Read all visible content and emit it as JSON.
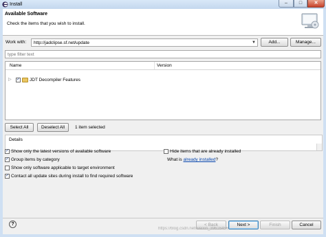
{
  "window": {
    "title": "Install"
  },
  "header": {
    "title": "Available Software",
    "description": "Check the items that you wish to install."
  },
  "work_with": {
    "label": "Work with:",
    "value": "http://jadclipse.sf.net/update",
    "add_label": "Add...",
    "manage_label": "Manage..."
  },
  "filter": {
    "placeholder": "type filter text"
  },
  "tree": {
    "columns": [
      "Name",
      "Version"
    ],
    "items": [
      {
        "label": "JDT Decompiler Features",
        "version": "",
        "checked": true
      }
    ]
  },
  "selection": {
    "select_all": "Select All",
    "deselect_all": "Deselect All",
    "status": "1 item selected"
  },
  "details": {
    "title": "Details"
  },
  "options": {
    "latest_versions": "Show only the latest versions of available software",
    "group_by_category": "Group items by category",
    "applicable_only": "Show only software applicable to target environment",
    "contact_sites": "Contact all update sites during install to find required software",
    "hide_installed": "Hide items that are already installed",
    "what_is_prefix": "What is ",
    "what_is_link": "already installed",
    "what_is_suffix": "?"
  },
  "buttons": {
    "back": "< Back",
    "next": "Next >",
    "finish": "Finish",
    "cancel": "Cancel",
    "help": "?"
  },
  "watermark": "https://blog.csdn.net/weixin_39616456"
}
